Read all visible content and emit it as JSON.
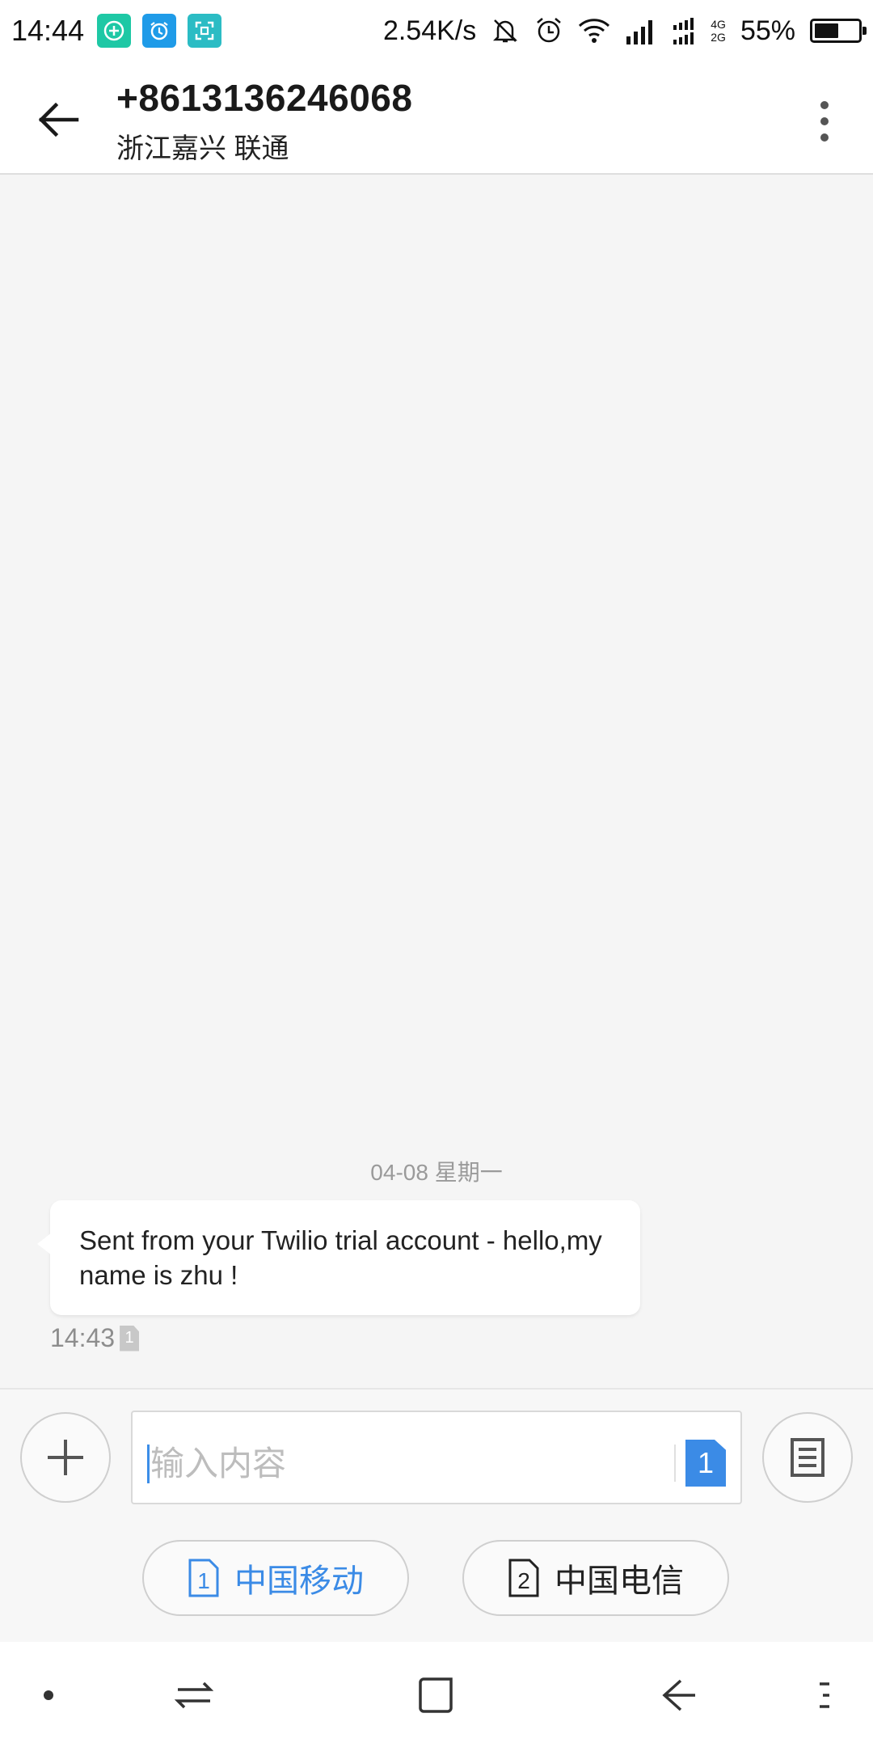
{
  "status_bar": {
    "time": "14:44",
    "net_speed": "2.54K/s",
    "network_types": [
      "4G",
      "2G"
    ],
    "battery": "55%",
    "battery_level": 0.55,
    "app_icons": [
      "plus-circle-app-icon",
      "alarm-app-icon",
      "scan-app-icon"
    ],
    "status_icons": [
      "bell-muted-icon",
      "alarm-clock-icon",
      "wifi-icon",
      "signal-icon",
      "dual-signal-icon"
    ]
  },
  "header": {
    "title": "+8613136246068",
    "subtitle": "浙江嘉兴 联通"
  },
  "conversation": {
    "date_separator": "04-08  星期一",
    "messages": [
      {
        "text": "Sent from your Twilio trial account - hello,my name is zhu !",
        "time": "14:43",
        "sim": "1"
      }
    ]
  },
  "composer": {
    "placeholder": "输入内容",
    "send_sim": "1"
  },
  "sim_options": [
    {
      "slot": "1",
      "label": "中国移动",
      "selected": true
    },
    {
      "slot": "2",
      "label": "中国电信",
      "selected": false
    }
  ],
  "colors": {
    "accent": "#3b8be6",
    "app_green": "#1ec8a5",
    "app_blue": "#1f9be8",
    "app_teal": "#2bbcc4"
  }
}
